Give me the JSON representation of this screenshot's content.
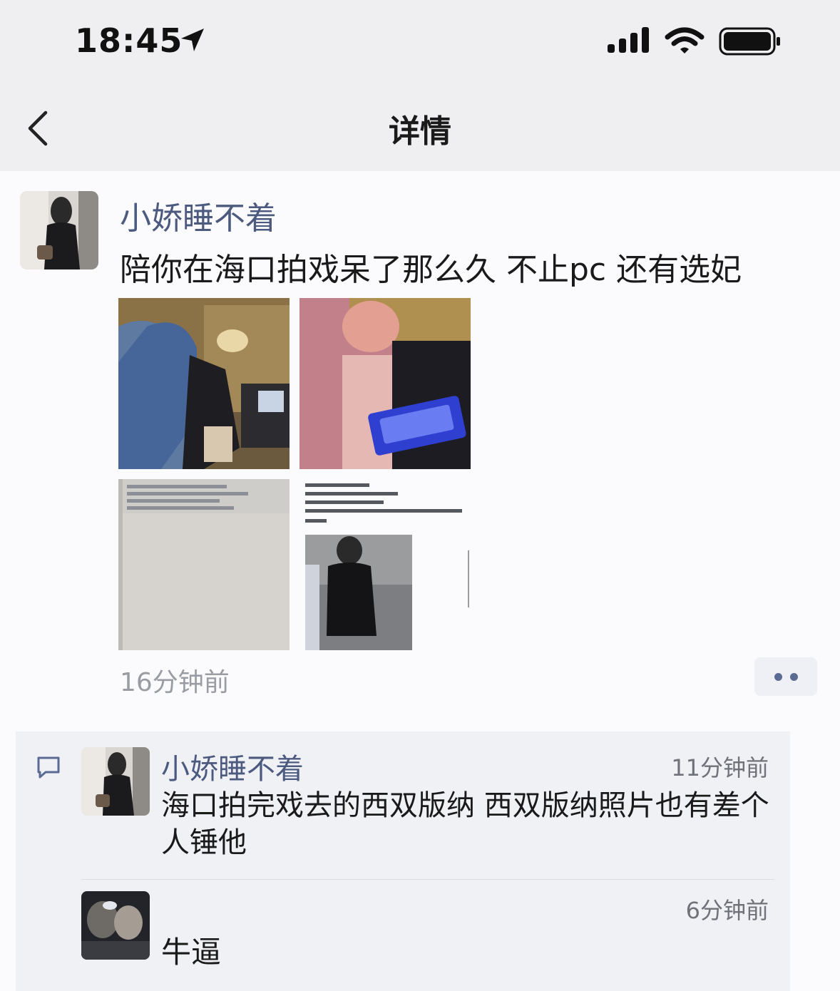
{
  "status_bar": {
    "time": "18:45"
  },
  "nav": {
    "title": "详情"
  },
  "post": {
    "author": "小娇睡不着",
    "text": "陪你在海口拍戏呆了那么久 不止pc 还有选妃",
    "time": "16分钟前",
    "photo_count": 4
  },
  "comments": [
    {
      "author": "小娇睡不着",
      "time": "11分钟前",
      "text": "海口拍完戏去的西双版纳 西双版纳照片也有差个人锤他"
    },
    {
      "author": "",
      "time": "6分钟前",
      "text": "牛逼"
    }
  ],
  "colors": {
    "name_link": "#4b5a7e",
    "bar_bg": "#efeff1",
    "page_bg": "#fbfbfd",
    "comment_bg": "#f0f1f5"
  }
}
